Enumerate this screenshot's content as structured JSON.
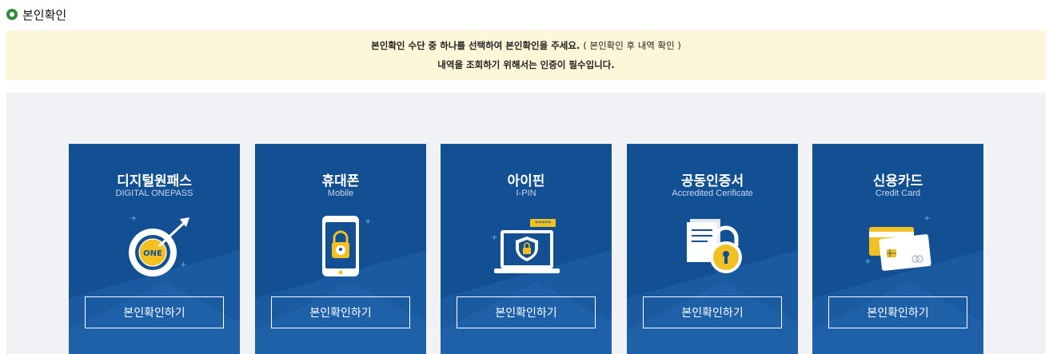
{
  "page": {
    "title": "본인확인"
  },
  "notice": {
    "line1_main": "본인확인 수단 중 하나를 선택하여 본인확인을 주세요.",
    "line1_paren": "( 본인확인 후 내역 확인 )",
    "line2": "내역을 조회하기 위해서는 인증이 필수입니다."
  },
  "cards": [
    {
      "name": "디지털원패스",
      "sub": "DIGITAL ONEPASS",
      "icon": "target-one-icon",
      "button": "본인확인하기"
    },
    {
      "name": "휴대폰",
      "sub": "Mobile",
      "icon": "phone-lock-icon",
      "button": "본인확인하기"
    },
    {
      "name": "아이핀",
      "sub": "I-PIN",
      "icon": "laptop-shield-icon",
      "button": "본인확인하기"
    },
    {
      "name": "공동인증서",
      "sub": "Accredited Cerificate",
      "icon": "certificate-lock-icon",
      "button": "본인확인하기"
    },
    {
      "name": "신용카드",
      "sub": "Credit Card",
      "icon": "credit-card-icon",
      "button": "본인확인하기"
    }
  ],
  "colors": {
    "card_bg": "#134f93",
    "notice_bg": "#fdf6d8",
    "panel_bg": "#f1f2f6",
    "accent_yellow": "#f2c021",
    "title_dot": "#2e8b3a"
  }
}
